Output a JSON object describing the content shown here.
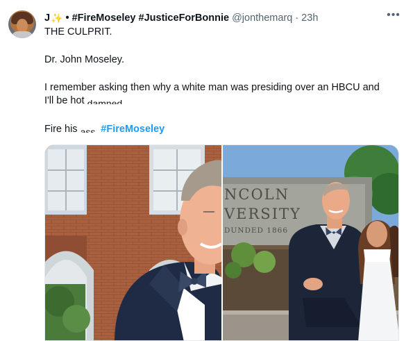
{
  "tweet": {
    "display_name": "J",
    "name_emoji": "✨",
    "name_hashtags": "• #FireMoseley #JusticeForBonnie",
    "handle": "@jonthemarq",
    "timestamp": "· 23h",
    "more_icon": "more-horizontal-icon",
    "body": {
      "line1": "THE CULPRIT.",
      "line2": "Dr. John Moseley.",
      "line3a": "I remember asking then why a white man was presiding over an HBCU and",
      "line3b_prefix": "I'll be hot ",
      "line3b_obscured": "damned.",
      "line4_prefix": "Fire his ",
      "line4_obscured": "ass.",
      "hashtag": "#FireMoseley"
    }
  },
  "media": {
    "photo_right_sign_lines": [
      "NCOLN",
      "VERSITY",
      "DUNDED 1866"
    ]
  },
  "colors": {
    "link": "#1d9bf0",
    "text": "#0f1419",
    "secondary": "#536471"
  }
}
